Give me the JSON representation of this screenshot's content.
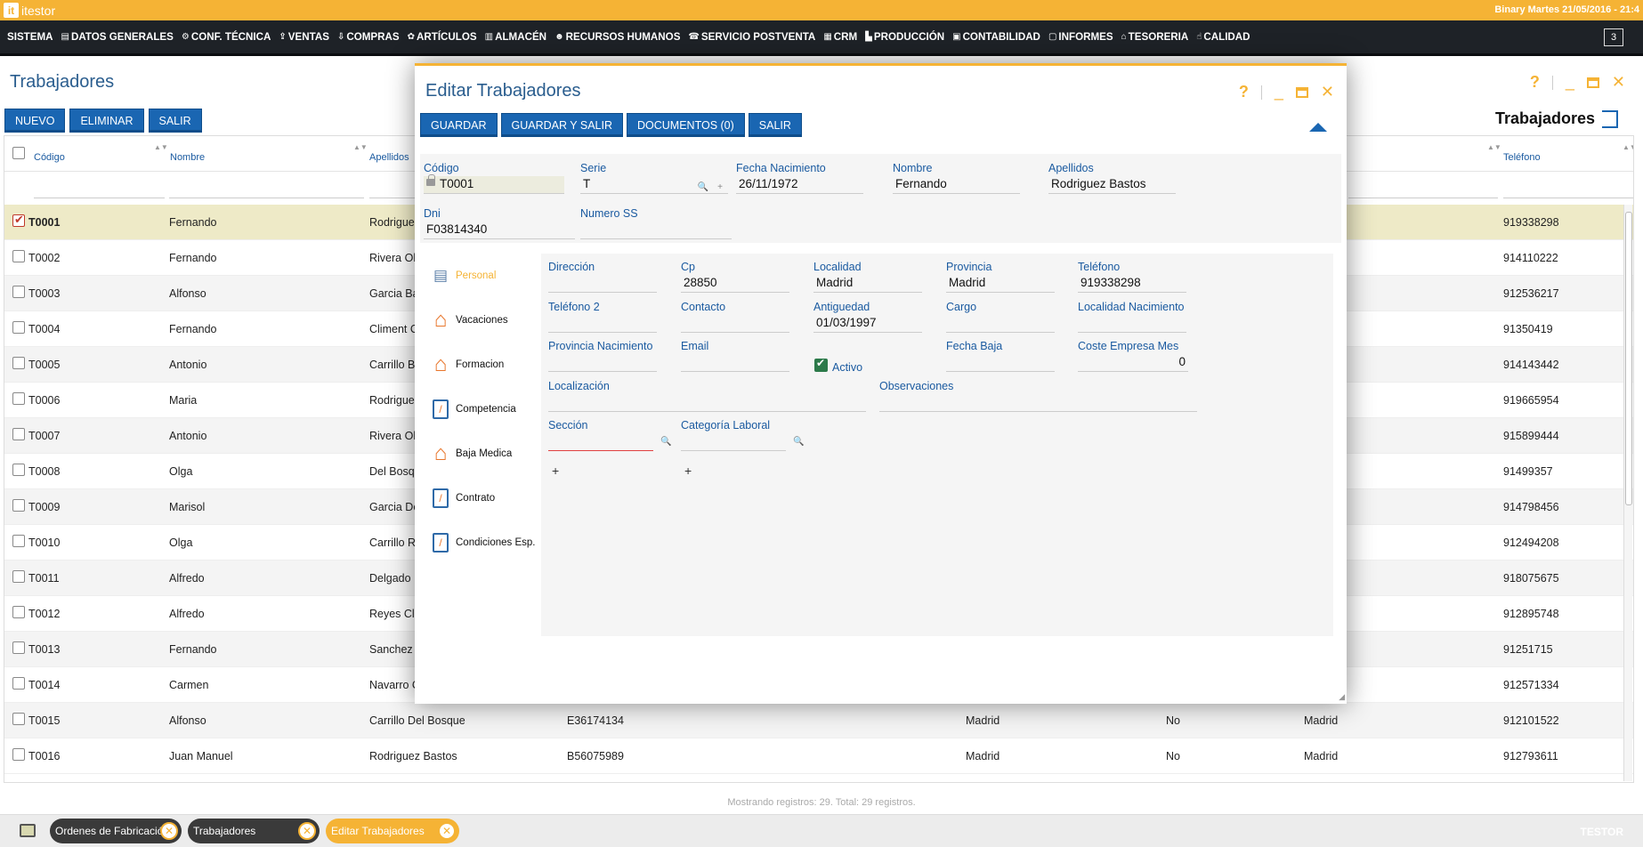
{
  "app": {
    "logo_mark": "it",
    "name": "itestor",
    "status": "Binary  Martes 21/05/2016 - 21:4"
  },
  "menu": [
    {
      "icon": "",
      "label": "SISTEMA"
    },
    {
      "icon": "▤",
      "label": "DATOS GENERALES"
    },
    {
      "icon": "⚙",
      "label": "CONF. TÉCNICA"
    },
    {
      "icon": "⇪",
      "label": "VENTAS"
    },
    {
      "icon": "⇩",
      "label": "COMPRAS"
    },
    {
      "icon": "✿",
      "label": "ARTÍCULOS"
    },
    {
      "icon": "▥",
      "label": "ALMACÉN"
    },
    {
      "icon": "☻",
      "label": "RECURSOS HUMANOS"
    },
    {
      "icon": "☎",
      "label": "SERVICIO POSTVENTA"
    },
    {
      "icon": "▦",
      "label": "CRM"
    },
    {
      "icon": "▙",
      "label": "PRODUCCIÓN"
    },
    {
      "icon": "▣",
      "label": "CONTABILIDAD"
    },
    {
      "icon": "▢",
      "label": "INFORMES"
    },
    {
      "icon": "⌂",
      "label": "TESORERIA"
    },
    {
      "icon": "☝",
      "label": "CALIDAD"
    }
  ],
  "menu_counter": "3",
  "page": {
    "title": "Trabajadores",
    "right_title": "Trabajadores",
    "buttons": {
      "nuevo": "NUEVO",
      "eliminar": "ELIMINAR",
      "salir": "SALIR"
    },
    "columns": {
      "codigo": "Código",
      "nombre": "Nombre",
      "apellidos": "Apellidos",
      "telefono": "Teléfono"
    },
    "rows": [
      {
        "codigo": "T0001",
        "nombre": "Fernando",
        "apellidos": "Rodriguez",
        "dni": "",
        "localidad": "",
        "activo": "",
        "provincia": "",
        "telefono": "919338298",
        "selected": true
      },
      {
        "codigo": "T0002",
        "nombre": "Fernando",
        "apellidos": "Rivera Ol",
        "dni": "",
        "localidad": "",
        "activo": "",
        "provincia": "",
        "telefono": "914110222"
      },
      {
        "codigo": "T0003",
        "nombre": "Alfonso",
        "apellidos": "Garcia Ba",
        "dni": "",
        "localidad": "",
        "activo": "",
        "provincia": "",
        "telefono": "912536217"
      },
      {
        "codigo": "T0004",
        "nombre": "Fernando",
        "apellidos": "Climent C",
        "dni": "",
        "localidad": "",
        "activo": "",
        "provincia": "",
        "telefono": "91350419"
      },
      {
        "codigo": "T0005",
        "nombre": "Antonio",
        "apellidos": "Carrillo B",
        "dni": "",
        "localidad": "",
        "activo": "",
        "provincia": "",
        "telefono": "914143442"
      },
      {
        "codigo": "T0006",
        "nombre": "Maria",
        "apellidos": "Rodrigue",
        "dni": "",
        "localidad": "",
        "activo": "",
        "provincia": "",
        "telefono": "919665954"
      },
      {
        "codigo": "T0007",
        "nombre": "Antonio",
        "apellidos": "Rivera Ol",
        "dni": "",
        "localidad": "",
        "activo": "",
        "provincia": "",
        "telefono": "915899444"
      },
      {
        "codigo": "T0008",
        "nombre": "Olga",
        "apellidos": "Del Bosqu",
        "dni": "",
        "localidad": "",
        "activo": "",
        "provincia": "",
        "telefono": "91499357"
      },
      {
        "codigo": "T0009",
        "nombre": "Marisol",
        "apellidos": "Garcia De",
        "dni": "",
        "localidad": "",
        "activo": "",
        "provincia": "",
        "telefono": "914798456"
      },
      {
        "codigo": "T0010",
        "nombre": "Olga",
        "apellidos": "Carrillo R",
        "dni": "",
        "localidad": "",
        "activo": "",
        "provincia": "",
        "telefono": "912494208"
      },
      {
        "codigo": "T0011",
        "nombre": "Alfredo",
        "apellidos": "Delgado F",
        "dni": "",
        "localidad": "",
        "activo": "",
        "provincia": "",
        "telefono": "918075675"
      },
      {
        "codigo": "T0012",
        "nombre": "Alfredo",
        "apellidos": "Reyes Cl",
        "dni": "",
        "localidad": "",
        "activo": "",
        "provincia": "",
        "telefono": "912895748"
      },
      {
        "codigo": "T0013",
        "nombre": "Fernando",
        "apellidos": "Sanchez",
        "dni": "",
        "localidad": "",
        "activo": "",
        "provincia": "",
        "telefono": "91251715"
      },
      {
        "codigo": "T0014",
        "nombre": "Carmen",
        "apellidos": "Navarro C",
        "dni": "",
        "localidad": "",
        "activo": "",
        "provincia": "",
        "telefono": "912571334"
      },
      {
        "codigo": "T0015",
        "nombre": "Alfonso",
        "apellidos": "Carrillo Del Bosque",
        "dni": "E36174134",
        "localidad": "Madrid",
        "activo": "No",
        "provincia": "Madrid",
        "telefono": "912101522"
      },
      {
        "codigo": "T0016",
        "nombre": "Juan Manuel",
        "apellidos": "Rodriguez Bastos",
        "dni": "B56075989",
        "localidad": "Madrid",
        "activo": "No",
        "provincia": "Madrid",
        "telefono": "912793611"
      }
    ],
    "status": "Mostrando registros: 29. Total: 29 registros."
  },
  "taskbar": {
    "tabs": [
      "Ordenes de Fabricación",
      "Trabajadores",
      "Editar Trabajadores"
    ],
    "right": "TESTOR"
  },
  "modal": {
    "title": "Editar  Trabajadores",
    "buttons": {
      "guardar": "GUARDAR",
      "guardar_salir": "GUARDAR Y SALIR",
      "documentos": "DOCUMENTOS (0)",
      "salir": "SALIR"
    },
    "head": {
      "codigo": {
        "label": "Código",
        "value": "T0001"
      },
      "serie": {
        "label": "Serie",
        "value": "T"
      },
      "fecha_nacimiento": {
        "label": "Fecha Nacimiento",
        "value": "26/11/1972"
      },
      "nombre": {
        "label": "Nombre",
        "value": "Fernando"
      },
      "apellidos": {
        "label": "Apellidos",
        "value": "Rodriguez Bastos"
      },
      "dni": {
        "label": "Dni",
        "value": "F03814340"
      },
      "numero_ss": {
        "label": "Numero SS",
        "value": ""
      }
    },
    "tabs": [
      {
        "label": "Personal",
        "icon": "person-icon"
      },
      {
        "label": "Vacaciones",
        "icon": "house-icon"
      },
      {
        "label": "Formacion",
        "icon": "house-icon"
      },
      {
        "label": "Competencia",
        "icon": "note-icon"
      },
      {
        "label": "Baja Medica",
        "icon": "house-icon"
      },
      {
        "label": "Contrato",
        "icon": "note-icon"
      },
      {
        "label": "Condiciones Esp.",
        "icon": "note-icon"
      }
    ],
    "personal": {
      "direccion": {
        "label": "Dirección",
        "value": ""
      },
      "cp": {
        "label": "Cp",
        "value": "28850"
      },
      "localidad": {
        "label": "Localidad",
        "value": "Madrid"
      },
      "provincia": {
        "label": "Provincia",
        "value": "Madrid"
      },
      "telefono": {
        "label": "Teléfono",
        "value": "919338298"
      },
      "telefono2": {
        "label": "Teléfono 2",
        "value": ""
      },
      "contacto": {
        "label": "Contacto",
        "value": ""
      },
      "antiguedad": {
        "label": "Antiguedad",
        "value": "01/03/1997"
      },
      "cargo": {
        "label": "Cargo",
        "value": ""
      },
      "localidad_nacimiento": {
        "label": "Localidad Nacimiento",
        "value": ""
      },
      "provincia_nacimiento": {
        "label": "Provincia Nacimiento",
        "value": ""
      },
      "email": {
        "label": "Email",
        "value": ""
      },
      "activo": {
        "label": "Activo",
        "checked": true
      },
      "fecha_baja": {
        "label": "Fecha Baja",
        "value": ""
      },
      "coste_empresa": {
        "label": "Coste Empresa Mes",
        "value": "0"
      },
      "localizacion": {
        "label": "Localización",
        "value": ""
      },
      "observaciones": {
        "label": "Observaciones",
        "value": ""
      },
      "seccion": {
        "label": "Sección",
        "value": ""
      },
      "categoria": {
        "label": "Categoría Laboral",
        "value": ""
      },
      "plus": "+"
    }
  }
}
